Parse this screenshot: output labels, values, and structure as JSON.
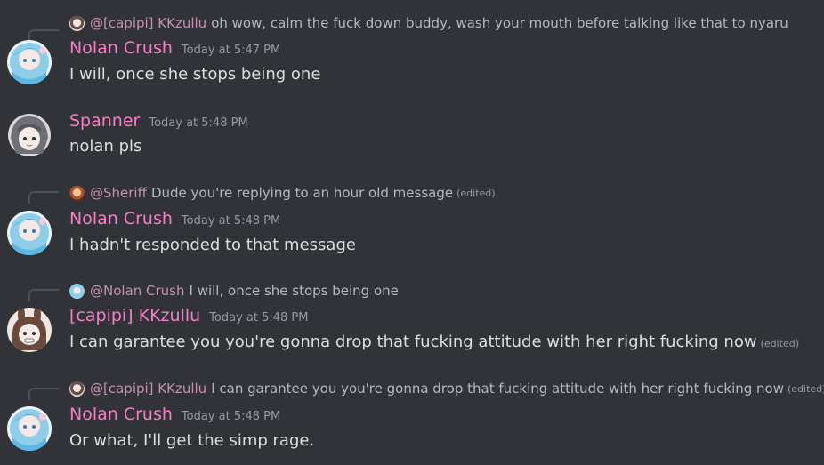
{
  "messages": [
    {
      "reply": {
        "name": "@[capipi] KKzullu",
        "text": "oh wow, calm the fuck down buddy, wash your mouth before talking like that to nyaru",
        "edited": ""
      },
      "author": "Nolan Crush",
      "avatar_icon": "anime-girl-blue-avatar",
      "timestamp": "Today at 5:47 PM",
      "content": "I will, once she stops being one",
      "edited": ""
    },
    {
      "reply": null,
      "author": "Spanner",
      "avatar_icon": "anime-girl-gray-hair-avatar",
      "timestamp": "Today at 5:48 PM",
      "content": "nolan pls",
      "edited": ""
    },
    {
      "reply": {
        "name": "@Sheriff",
        "text": "Dude you're replying to an hour old message",
        "edited": "(edited)"
      },
      "author": "Nolan Crush",
      "avatar_icon": "anime-girl-blue-avatar",
      "timestamp": "Today at 5:48 PM",
      "content": "I hadn't responded to that message",
      "edited": ""
    },
    {
      "reply": {
        "name": "@Nolan Crush",
        "text": "I will, once she stops being one",
        "edited": ""
      },
      "author": "[capipi] KKzullu",
      "avatar_icon": "anime-girl-bunny-ears-avatar",
      "timestamp": "Today at 5:48 PM",
      "content": "I can garantee you you're gonna drop that fucking attitude with her right fucking now",
      "edited": "(edited)"
    },
    {
      "reply": {
        "name": "@[capipi] KKzullu",
        "text": "I can garantee you you're gonna drop that fucking attitude with her right fucking now",
        "edited": "(edited)"
      },
      "author": "Nolan Crush",
      "avatar_icon": "anime-girl-blue-avatar",
      "timestamp": "Today at 5:48 PM",
      "content": "Or what, I'll get the simp rage.",
      "edited": ""
    }
  ],
  "colors": {
    "background": "#313338",
    "username": "#f47fc4",
    "reply_name": "#c490b5",
    "message_text": "#dbdee1",
    "muted_text": "#949ba4"
  }
}
